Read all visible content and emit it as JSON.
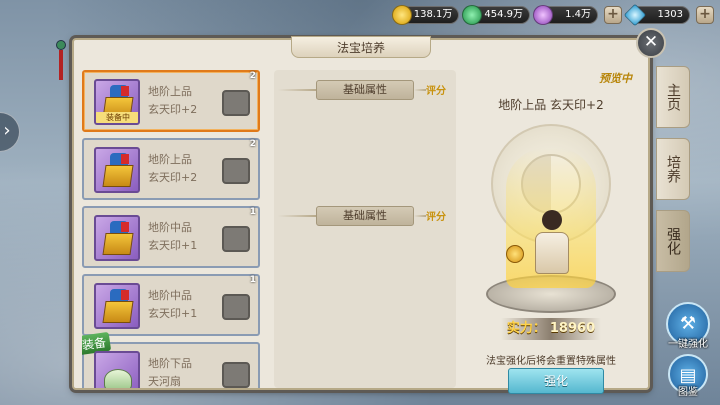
{
  "currencies": [
    {
      "value": "138.1万",
      "color": "#f2c31a",
      "icon": "gold-coin-icon"
    },
    {
      "value": "454.9万",
      "color": "#2fbf5a",
      "icon": "jade-coin-icon"
    },
    {
      "value": "1.4万",
      "color": "#c06ae0",
      "icon": "spirit-orb-icon"
    },
    {
      "value": "1303",
      "color": "#5cc8f2",
      "icon": "diamond-icon"
    }
  ],
  "panel": {
    "title": "法宝培养"
  },
  "list": [
    {
      "name1": "地阶上品",
      "name2": "玄天印+2",
      "level": "2",
      "tag": "装备中",
      "selected": true
    },
    {
      "name1": "地阶上品",
      "name2": "玄天印+2",
      "level": "2",
      "tag": "",
      "selected": false
    },
    {
      "name1": "地阶中品",
      "name2": "玄天印+1",
      "level": "1",
      "tag": "",
      "selected": false
    },
    {
      "name1": "地阶中品",
      "name2": "玄天印+1",
      "level": "1",
      "tag": "",
      "selected": false
    },
    {
      "name1": "地阶下品",
      "name2": "天河扇",
      "level": "",
      "tag": "",
      "badge": "装备",
      "selected": false
    }
  ],
  "middle": {
    "section1": {
      "label": "基础属性",
      "score": "评分"
    },
    "section2": {
      "label": "基础属性",
      "score": "评分"
    }
  },
  "preview": {
    "tag": "预览中",
    "item_title": "地阶上品 玄天印+2",
    "power_label": "实力：",
    "power_value": "18960",
    "notice": "法宝强化后将会重置特殊属性",
    "button": "强化"
  },
  "tabs": [
    {
      "label": "主页",
      "active": false
    },
    {
      "label": "培养",
      "active": false
    },
    {
      "label": "强化",
      "active": true
    }
  ],
  "actions": {
    "one_key": "一键强化",
    "atlas": "图鉴"
  }
}
